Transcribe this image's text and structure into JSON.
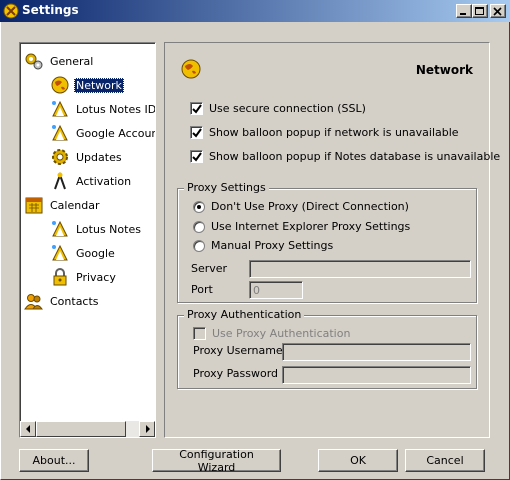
{
  "window": {
    "title": "Settings",
    "controls": [
      "minimize-icon",
      "maximize-icon",
      "close-icon"
    ]
  },
  "tree": {
    "items": [
      {
        "label": "General",
        "icon": "gears-icon",
        "level": 0
      },
      {
        "label": "Network",
        "icon": "globe-icon",
        "level": 1,
        "selected": true
      },
      {
        "label": "Lotus Notes ID",
        "icon": "wizard-icon",
        "level": 1
      },
      {
        "label": "Google Account",
        "icon": "wizard-icon",
        "level": 1
      },
      {
        "label": "Updates",
        "icon": "gear-icon",
        "level": 1
      },
      {
        "label": "Activation",
        "icon": "wizard-icon",
        "level": 1
      },
      {
        "label": "Calendar",
        "icon": "calendar-icon",
        "level": 0
      },
      {
        "label": "Lotus Notes",
        "icon": "wizard-icon",
        "level": 1
      },
      {
        "label": "Google",
        "icon": "wizard-icon",
        "level": 1
      },
      {
        "label": "Privacy",
        "icon": "lock-icon",
        "level": 1
      },
      {
        "label": "Contacts",
        "icon": "contacts-icon",
        "level": 0
      }
    ]
  },
  "panel": {
    "heading": "Network",
    "options": [
      {
        "label": "Use secure connection (SSL)",
        "checked": true
      },
      {
        "label": "Show balloon popup if network is unavailable",
        "checked": true
      },
      {
        "label": "Show balloon popup if Notes database is unavailable",
        "checked": true
      }
    ],
    "proxy_settings": {
      "legend": "Proxy Settings",
      "radios": [
        {
          "label": "Don't Use Proxy (Direct Connection)",
          "selected": true
        },
        {
          "label": "Use Internet Explorer Proxy Settings",
          "selected": false
        },
        {
          "label": "Manual Proxy Settings",
          "selected": false
        }
      ],
      "server_label": "Server",
      "server_value": "",
      "port_label": "Port",
      "port_value": "0"
    },
    "proxy_auth": {
      "legend": "Proxy Authentication",
      "checkbox_label": "Use Proxy Authentication",
      "checked": false,
      "username_label": "Proxy Username",
      "username_value": "",
      "password_label": "Proxy Password",
      "password_value": ""
    }
  },
  "buttons": {
    "about": "About...",
    "wizard": "Configuration Wizard",
    "ok": "OK",
    "cancel": "Cancel"
  },
  "colors": {
    "titlebar_start": "#0a246a",
    "titlebar_end": "#a6caf0",
    "face": "#d4d0c8",
    "selection": "#0a246a"
  }
}
